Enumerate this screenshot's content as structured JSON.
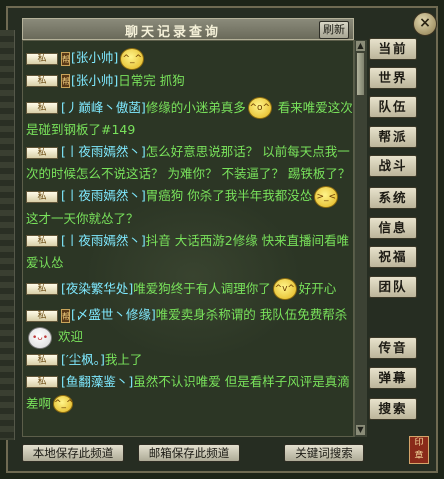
{
  "window": {
    "title": "聊天记录查询",
    "refresh_label": "刷新",
    "close_label": "×"
  },
  "chip_label": "私",
  "badge_label": "帮",
  "messages": [
    {
      "name": "[张小帅]",
      "text": "",
      "emoji": "emo"
    },
    {
      "name": "[张小帅]",
      "text": "日常完 抓狗"
    },
    {
      "name": "[丿巅峰丶傲菡]",
      "text": "修缘的小迷弟真多",
      "emoji": "emo",
      "text2": " 看来唯爱这次是碰到钢板了#149"
    },
    {
      "name": "[丨夜雨嫣然丶]",
      "text": "怎么好意思说那话？ 以前每天点我一次的时候怎么不说这话？ 为难你？ 不装逼了？ 踢铁板了？"
    },
    {
      "name": "[丨夜雨嫣然丶]",
      "text": "胃癌狗 你杀了我半年我都没怂",
      "emoji": "emo",
      "text2": " 这才一天你就怂了？"
    },
    {
      "name": "[丨夜雨嫣然丶]",
      "text": "抖音 大话西游2修缘 快来直播间看唯爱认怂"
    },
    {
      "name": "[夜染繁华处]",
      "text": "唯爱狗终于有人调理你了",
      "emoji": "emo",
      "text2": "好开心"
    },
    {
      "name": "[〆盛世丶修缘]",
      "text": "唯爱卖身杀称谓的 我队伍免费帮杀",
      "emoji": "emo",
      "text2": " 欢迎"
    },
    {
      "name": "[′尘枫。]",
      "text": "我上了"
    },
    {
      "name": "[鱼翻藻鉴丶]",
      "text": "虽然不认识唯爱 但是看样子风评是真滴差啊",
      "emoji": "emo"
    }
  ],
  "side_tabs": [
    "当前",
    "世界",
    "队伍",
    "帮派",
    "战斗",
    "系统",
    "信息",
    "祝福",
    "团队",
    "传音",
    "弹幕",
    "搜索"
  ],
  "bottom_buttons": [
    "本地保存此频道",
    "邮箱保存此频道",
    "关键词搜索"
  ],
  "colors": {
    "message_text": "#79e25b",
    "player_name": "#7fe9ff",
    "panel_bg": "#2c3625"
  }
}
